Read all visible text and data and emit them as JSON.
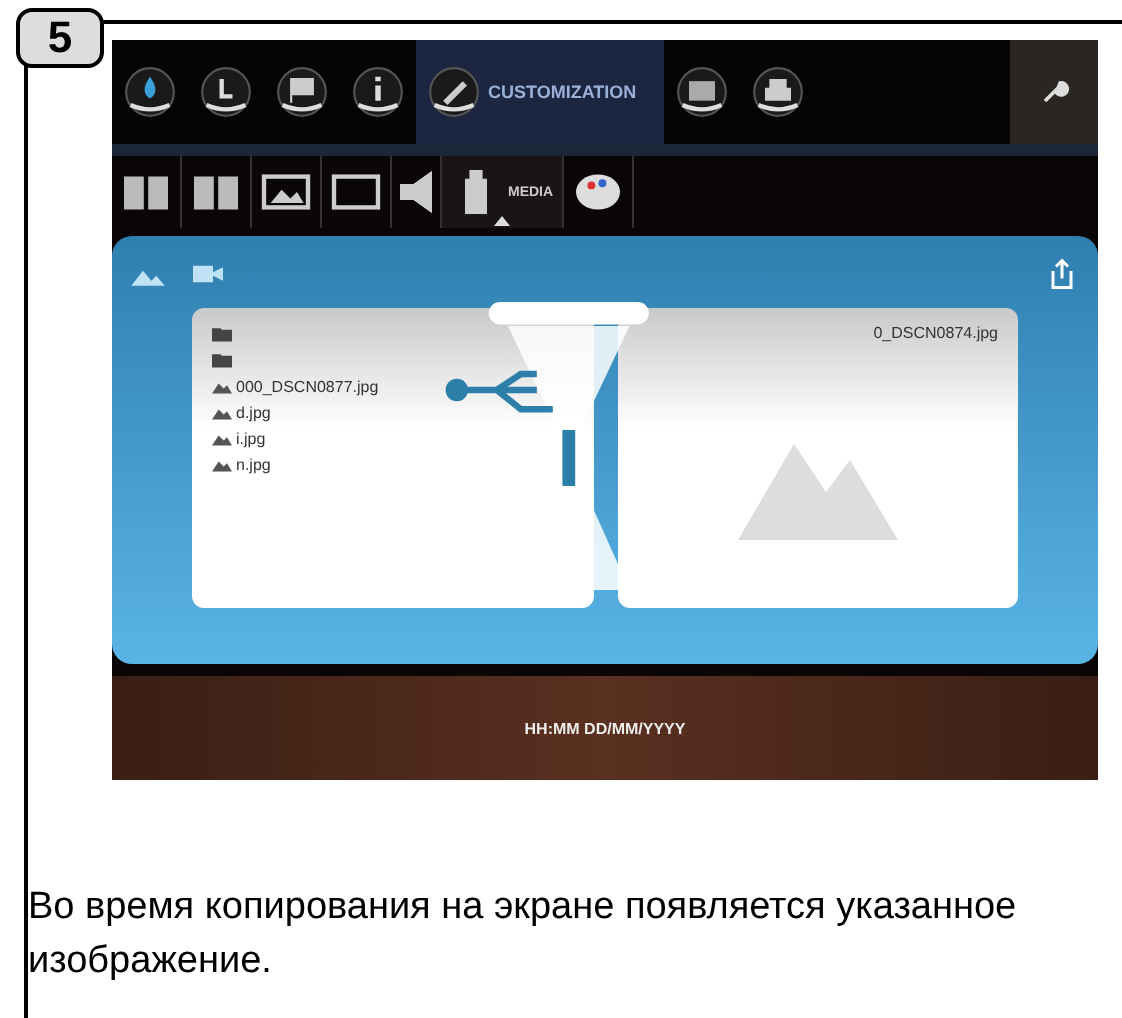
{
  "step": "5",
  "top_tabs": [
    {
      "kind": "drop",
      "selected": false
    },
    {
      "kind": "clock",
      "selected": false
    },
    {
      "kind": "flag",
      "selected": false
    },
    {
      "kind": "info",
      "selected": false
    },
    {
      "kind": "pencil",
      "label": "CUSTOMIZATION",
      "selected": true
    },
    {
      "kind": "monitor",
      "selected": false
    },
    {
      "kind": "printer",
      "selected": false
    }
  ],
  "sub_tabs": [
    {
      "kind": "book",
      "selected": false
    },
    {
      "kind": "book",
      "selected": false
    },
    {
      "kind": "image",
      "selected": false
    },
    {
      "kind": "frame",
      "selected": false
    },
    {
      "kind": "speaker",
      "selected": false
    },
    {
      "kind": "usb",
      "label": "MEDIA",
      "selected": true
    },
    {
      "kind": "palette",
      "selected": false
    }
  ],
  "file_list": [
    {
      "kind": "folder"
    },
    {
      "kind": "folder"
    },
    {
      "kind": "image",
      "name": "000_DSCN0877.jpg"
    },
    {
      "kind": "image",
      "name": "d.jpg"
    },
    {
      "kind": "image",
      "name": "i.jpg"
    },
    {
      "kind": "image",
      "name": "n.jpg"
    }
  ],
  "preview": {
    "name": "0_DSCN0874.jpg"
  },
  "status_bar": {
    "datetime": "HH:MM DD/MM/YYYY"
  },
  "caption": "Во время копирования на экране появляется указанное изображение."
}
